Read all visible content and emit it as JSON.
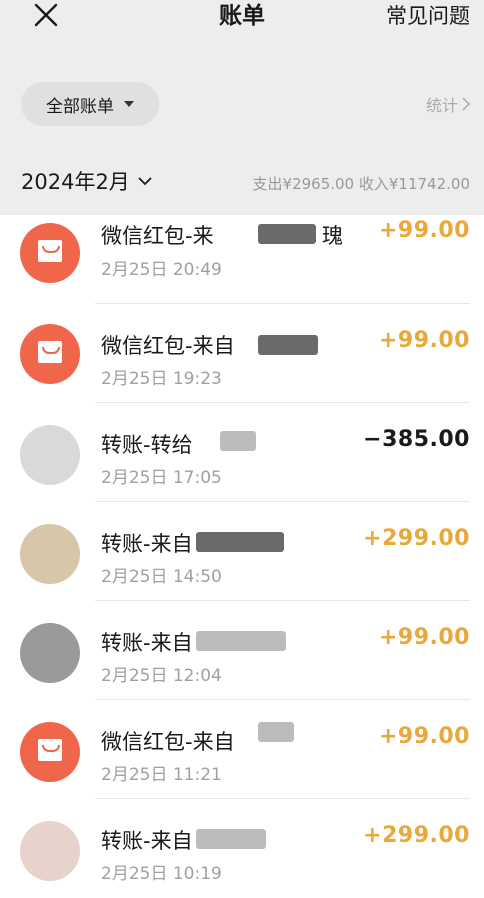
{
  "header": {
    "title": "账单",
    "faq_label": "常见问题",
    "close_icon": "close-icon"
  },
  "filter": {
    "label": "全部账单",
    "stats_label": "统计"
  },
  "month": {
    "label": "2024年2月",
    "summary": "支出¥2965.00 收入¥11742.00"
  },
  "transactions": [
    {
      "title": "微信红包-来",
      "tail": "瑰",
      "time": "2月25日 20:49",
      "amount": "+99.00",
      "type": "income",
      "icon": "red-packet-icon"
    },
    {
      "title": "微信红包-来自",
      "tail": "",
      "time": "2月25日 19:23",
      "amount": "+99.00",
      "type": "income",
      "icon": "red-packet-icon"
    },
    {
      "title": "转账-转给",
      "tail": "",
      "time": "2月25日 17:05",
      "amount": "−385.00",
      "type": "expense",
      "icon": "avatar"
    },
    {
      "title": "转账-来自",
      "tail": "",
      "time": "2月25日 14:50",
      "amount": "+299.00",
      "type": "income",
      "icon": "avatar"
    },
    {
      "title": "转账-来自",
      "tail": "",
      "time": "2月25日 12:04",
      "amount": "+99.00",
      "type": "income",
      "icon": "avatar"
    },
    {
      "title": "微信红包-来自",
      "tail": "",
      "time": "2月25日 11:21",
      "amount": "+99.00",
      "type": "income",
      "icon": "red-packet-icon"
    },
    {
      "title": "转账-来自",
      "tail": "",
      "time": "2月25日 10:19",
      "amount": "+299.00",
      "type": "income",
      "icon": "avatar"
    }
  ],
  "colors": {
    "income": "#e8a93a",
    "expense": "#1a1a1a",
    "red_packet": "#f0664a"
  }
}
